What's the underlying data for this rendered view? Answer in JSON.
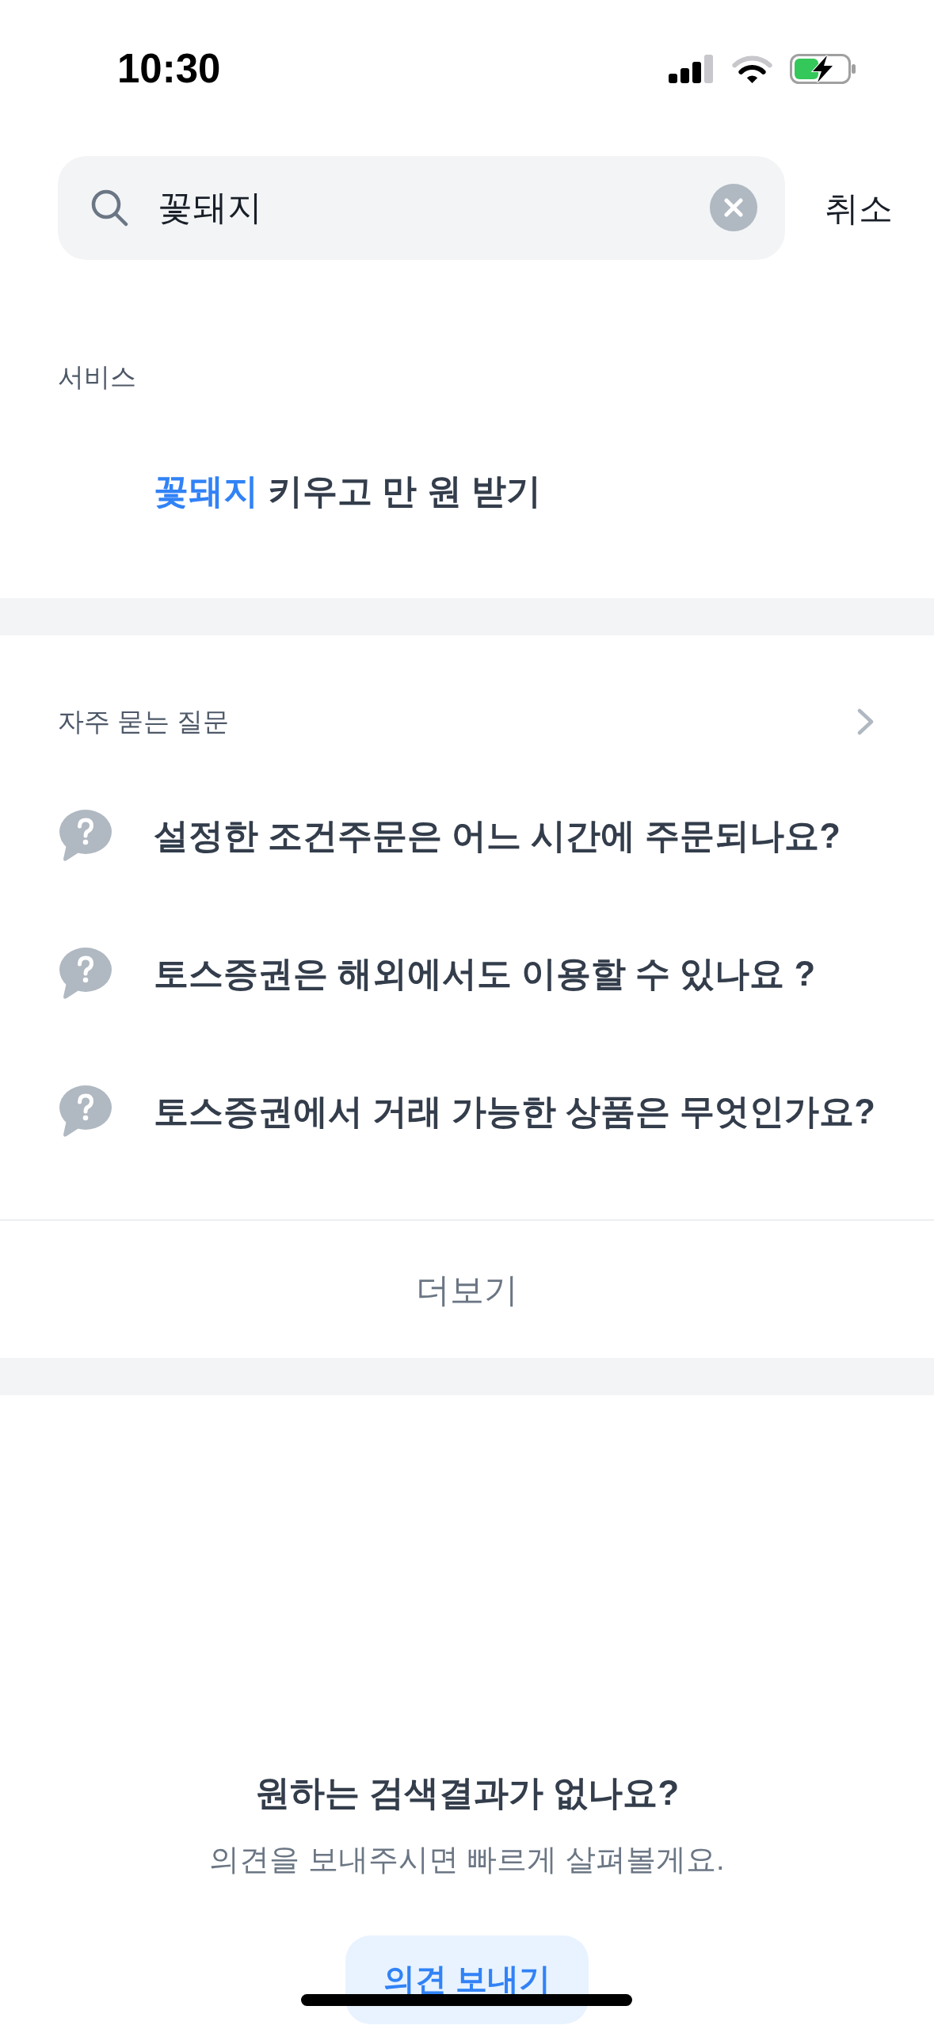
{
  "status_bar": {
    "time": "10:30"
  },
  "search": {
    "value": "꽃돼지",
    "cancel": "취소"
  },
  "services": {
    "title": "서비스",
    "items": [
      {
        "label": "**꽃돼지** 키우고 만 원 받기"
      }
    ]
  },
  "faq": {
    "title": "자주 묻는 질문",
    "items": [
      {
        "question": "설정한 조건주문은 어느 시간에 주문되나요?"
      },
      {
        "question": "토스증권은 해외에서도 이용할 수 있나요 ?"
      },
      {
        "question": "토스증권에서 거래 가능한 상품은 무엇인가요?"
      }
    ],
    "more": "더보기"
  },
  "feedback": {
    "title": "원하는 검색결과가 없나요?",
    "subtitle": "의견을 보내주시면 빠르게 살펴볼게요.",
    "button": "의견 보내기"
  }
}
